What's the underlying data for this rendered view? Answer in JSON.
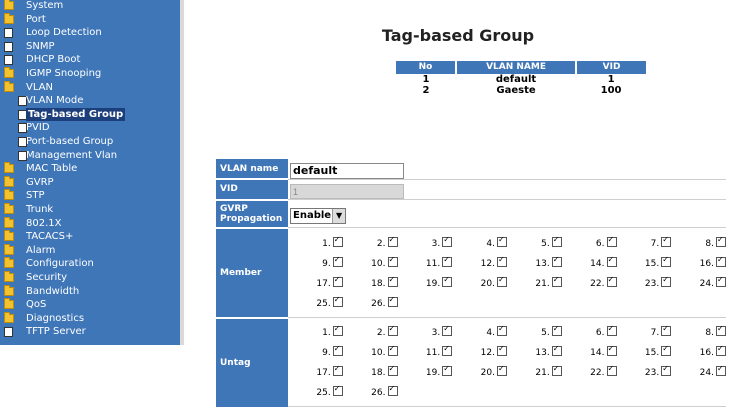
{
  "sidebar": {
    "items": [
      {
        "label": "System",
        "icon": "folder-icon",
        "level": 0
      },
      {
        "label": "Port",
        "icon": "folder-icon",
        "level": 0
      },
      {
        "label": "Loop Detection",
        "icon": "document-icon",
        "level": 0
      },
      {
        "label": "SNMP",
        "icon": "document-icon",
        "level": 0
      },
      {
        "label": "DHCP Boot",
        "icon": "document-icon",
        "level": 0
      },
      {
        "label": "IGMP Snooping",
        "icon": "folder-icon",
        "level": 0
      },
      {
        "label": "VLAN",
        "icon": "folder-icon",
        "level": 0
      },
      {
        "label": "VLAN Mode",
        "icon": "document-icon",
        "level": 1
      },
      {
        "label": "Tag-based Group",
        "icon": "document-icon",
        "level": 1,
        "selected": true
      },
      {
        "label": "PVID",
        "icon": "document-icon",
        "level": 1
      },
      {
        "label": "Port-based Group",
        "icon": "document-icon",
        "level": 1
      },
      {
        "label": "Management Vlan",
        "icon": "document-icon",
        "level": 1
      },
      {
        "label": "MAC Table",
        "icon": "folder-icon",
        "level": 0
      },
      {
        "label": "GVRP",
        "icon": "folder-icon",
        "level": 0
      },
      {
        "label": "STP",
        "icon": "folder-icon",
        "level": 0
      },
      {
        "label": "Trunk",
        "icon": "folder-icon",
        "level": 0
      },
      {
        "label": "802.1X",
        "icon": "folder-icon",
        "level": 0
      },
      {
        "label": "TACACS+",
        "icon": "folder-icon",
        "level": 0
      },
      {
        "label": "Alarm",
        "icon": "folder-icon",
        "level": 0
      },
      {
        "label": "Configuration",
        "icon": "folder-icon",
        "level": 0
      },
      {
        "label": "Security",
        "icon": "folder-icon",
        "level": 0
      },
      {
        "label": "Bandwidth",
        "icon": "folder-icon",
        "level": 0
      },
      {
        "label": "QoS",
        "icon": "folder-icon",
        "level": 0
      },
      {
        "label": "Diagnostics",
        "icon": "folder-icon",
        "level": 0
      },
      {
        "label": "TFTP Server",
        "icon": "document-icon",
        "level": 0
      }
    ]
  },
  "page": {
    "title": "Tag-based Group"
  },
  "vlan_table": {
    "headers": [
      "No",
      "VLAN NAME",
      "VID"
    ],
    "rows": [
      {
        "no": "1",
        "name": "default",
        "vid": "1"
      },
      {
        "no": "2",
        "name": "Gaeste",
        "vid": "100"
      }
    ]
  },
  "form": {
    "vlan_name_label": "VLAN name",
    "vlan_name_value": "default",
    "vid_label": "VID",
    "vid_value": "1",
    "gvrp_label_1": "GVRP",
    "gvrp_label_2": "Propagation",
    "gvrp_value": "Enable",
    "member_label": "Member",
    "untag_label": "Untag",
    "member_ports": [
      "1.",
      "2.",
      "3.",
      "4.",
      "5.",
      "6.",
      "7.",
      "8.",
      "9.",
      "10.",
      "11.",
      "12.",
      "13.",
      "14.",
      "15.",
      "16.",
      "17.",
      "18.",
      "19.",
      "20.",
      "21.",
      "22.",
      "23.",
      "24.",
      "25.",
      "26."
    ],
    "untag_ports": [
      "1.",
      "2.",
      "3.",
      "4.",
      "5.",
      "6.",
      "7.",
      "8.",
      "9.",
      "10.",
      "11.",
      "12.",
      "13.",
      "14.",
      "15.",
      "16.",
      "17.",
      "18.",
      "19.",
      "20.",
      "21.",
      "22.",
      "23.",
      "24.",
      "25.",
      "26."
    ]
  },
  "colors": {
    "sidebar_bg": "#3f76b8",
    "header_bg": "#3f76b8",
    "selected_bg": "#1c3e7a",
    "folder": "#f2c230"
  }
}
